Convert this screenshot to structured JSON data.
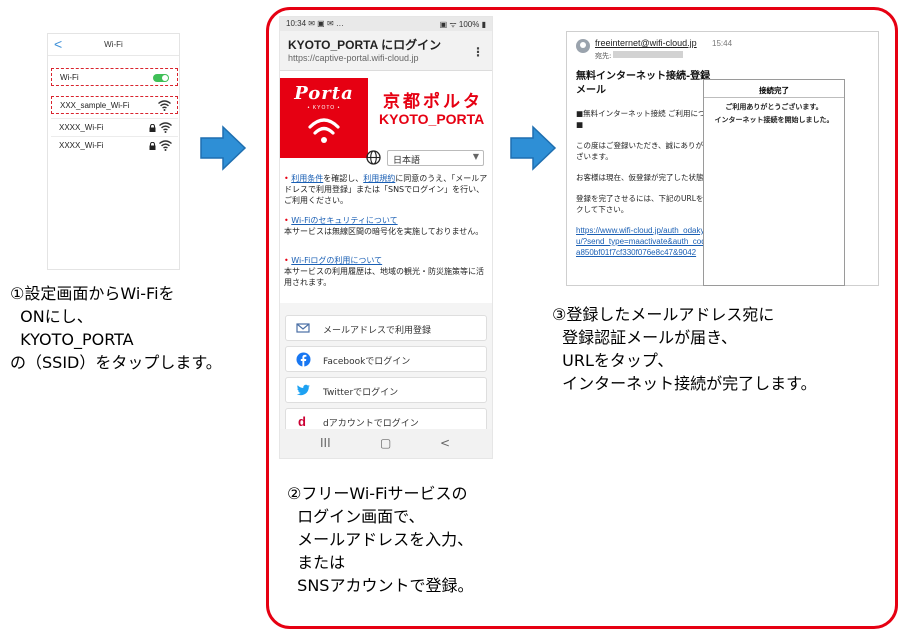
{
  "step1": {
    "header_back": "<",
    "header_title": "Wi-Fi",
    "wifi_toggle_label": "Wi-Fi",
    "networks": [
      {
        "ssid": "XXX_sample_Wi-Fi",
        "locked": false
      },
      {
        "ssid": "XXXX_Wi-Fi",
        "locked": true
      },
      {
        "ssid": "XXXX_Wi-Fi",
        "locked": true
      }
    ],
    "caption": "①設定画面からWi-Fiを\n  ONにし、\n  KYOTO_PORTA\nの（SSID）をタップします。"
  },
  "step2": {
    "status_left": "10:34 ✉ ▣ ✉ …",
    "status_right": "▣ ᯤ 100% ▮",
    "browser_title": "KYOTO_PORTA にログイン",
    "browser_url": "https://captive-portal.wifi-cloud.jp",
    "menu_glyph": "⋮",
    "logo_text": "Porta",
    "logo_sub": "• KYOTO •",
    "brand_jp": "京都ポルタ",
    "brand_en": "KYOTO_PORTA",
    "language": "日本語",
    "language_caret": "▼",
    "terms_link_1": "利用条件",
    "terms_mid": "を確認し、",
    "terms_link_2": "利用規約",
    "terms_rest": "に同意のうえ、「メールアドレスで利用登録」または「SNSでログイン」を行い、ご利用ください。",
    "security_link": "Wi-Fiのセキュリティについて",
    "security_text": "本サービスは無線区間の暗号化を実施しておりません。",
    "log_link": "Wi-Fiログの利用について",
    "log_text": "本サービスの利用履歴は、地域の観光・防災施策等に活用されます。",
    "buttons": [
      {
        "label": "メールアドレスで利用登録",
        "icon": "mail-icon"
      },
      {
        "label": "Facebookでログイン",
        "icon": "facebook-icon"
      },
      {
        "label": "Twitterでログイン",
        "icon": "twitter-icon"
      },
      {
        "label": "dアカウントでログイン",
        "icon": "d-account-icon"
      }
    ],
    "nav": [
      "III",
      "▢",
      "<"
    ],
    "caption": "②フリーWi-Fiサービスの\n  ログイン画面で、\n  メールアドレスを入力、\n  または\n  SNSアカウントで登録。"
  },
  "step3": {
    "sender": "freeinternet@wifi-cloud.jp",
    "time": "15:44",
    "to_label": "宛先:",
    "subject": "無料インターネット接続-登録\nメール",
    "body_1": "■無料インターネット接続 ご利用について■",
    "body_2": "この度はご登録いただき、誠にありがとうございます。",
    "body_3": "お客様は現在、仮登録が完了した状態です。",
    "body_4": "登録を完了させるには、下記のURLをクリックして下さい。",
    "link": "https://www.wifi-cloud.jp/auth_odakyubus_u/?send_type=maactivate&auth_code=d9a850bf01f7cf330f076e8c47&9042",
    "dialog_title": "接続完了",
    "dialog_line_1": "ご利用ありがとうございます。",
    "dialog_line_2": "インターネット接続を開始しました。",
    "caption": "③登録したメールアドレス宛に\n  登録認証メールが届き、\n  URLをタップ、\n  インターネット接続が完了します。"
  },
  "colors": {
    "accent_red": "#e60012",
    "arrow_blue": "#2e8fd6",
    "link_blue": "#1a5fb4",
    "toggle_green": "#3fbf57"
  }
}
